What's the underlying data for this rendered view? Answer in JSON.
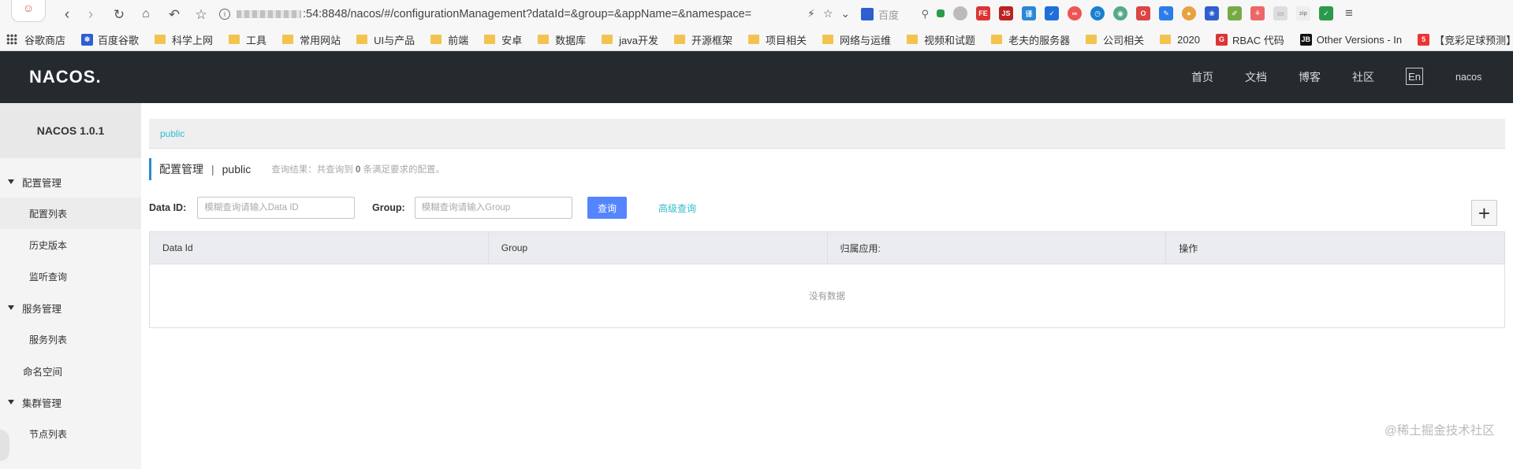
{
  "browser": {
    "url_masked_part": "54:8848",
    "url": ":54:8848/nacos/#/configurationManagement?dataId=&group=&appName=&namespace=",
    "search_placeholder": "百度",
    "bookmarks": [
      {
        "label": "谷歌商店",
        "icon": "apps-grid-icon"
      },
      {
        "label": "百度谷歌",
        "icon": "baidu-icon"
      },
      {
        "label": "科学上网",
        "icon": "folder-icon"
      },
      {
        "label": "工具",
        "icon": "folder-icon"
      },
      {
        "label": "常用网站",
        "icon": "folder-icon"
      },
      {
        "label": "UI与产品",
        "icon": "folder-icon"
      },
      {
        "label": "前端",
        "icon": "folder-icon"
      },
      {
        "label": "安卓",
        "icon": "folder-icon"
      },
      {
        "label": "数据库",
        "icon": "folder-icon"
      },
      {
        "label": "java开发",
        "icon": "folder-icon"
      },
      {
        "label": "开源框架",
        "icon": "folder-icon"
      },
      {
        "label": "项目相关",
        "icon": "folder-icon"
      },
      {
        "label": "网络与运维",
        "icon": "folder-icon"
      },
      {
        "label": "视频和试题",
        "icon": "folder-icon"
      },
      {
        "label": "老夫的服务器",
        "icon": "folder-icon"
      },
      {
        "label": "公司相关",
        "icon": "folder-icon"
      },
      {
        "label": "2020",
        "icon": "folder-icon"
      },
      {
        "label": "RBAC 代码",
        "icon": "g-icon"
      },
      {
        "label": "Other Versions - In",
        "icon": "jb-icon"
      },
      {
        "label": "【竞彩足球预测】足",
        "icon": "five-icon"
      }
    ]
  },
  "header": {
    "logo": "NACOS.",
    "nav": [
      "首页",
      "文档",
      "博客",
      "社区"
    ],
    "lang": "En",
    "user": "nacos"
  },
  "sidebar": {
    "title": "NACOS 1.0.1",
    "groups": [
      {
        "label": "配置管理",
        "items": [
          "配置列表",
          "历史版本",
          "监听查询"
        ]
      },
      {
        "label": "服务管理",
        "items": [
          "服务列表"
        ]
      },
      {
        "plain": "命名空间"
      },
      {
        "label": "集群管理",
        "items": [
          "节点列表"
        ]
      }
    ]
  },
  "main": {
    "namespace_tab": "public",
    "page_title": "配置管理",
    "separator": "|",
    "namespace": "public",
    "result_prefix": "查询结果：共查询到",
    "result_count": "0",
    "result_suffix": "条满足要求的配置。",
    "filters": {
      "data_id_label": "Data ID:",
      "data_id_placeholder": "模糊查询请输入Data ID",
      "group_label": "Group:",
      "group_placeholder": "模糊查询请输入Group",
      "query_button": "查询",
      "advanced_link": "高级查询",
      "add_button": "+"
    },
    "table": {
      "columns": [
        "Data Id",
        "Group",
        "归属应用:",
        "操作"
      ],
      "empty_text": "没有数据"
    }
  },
  "watermark": "@稀土掘金技术社区",
  "colors": {
    "header_bg": "#252a2f",
    "primary": "#5584ff",
    "link": "#33bbcc",
    "sidebar_bg": "#f4f4f4"
  }
}
